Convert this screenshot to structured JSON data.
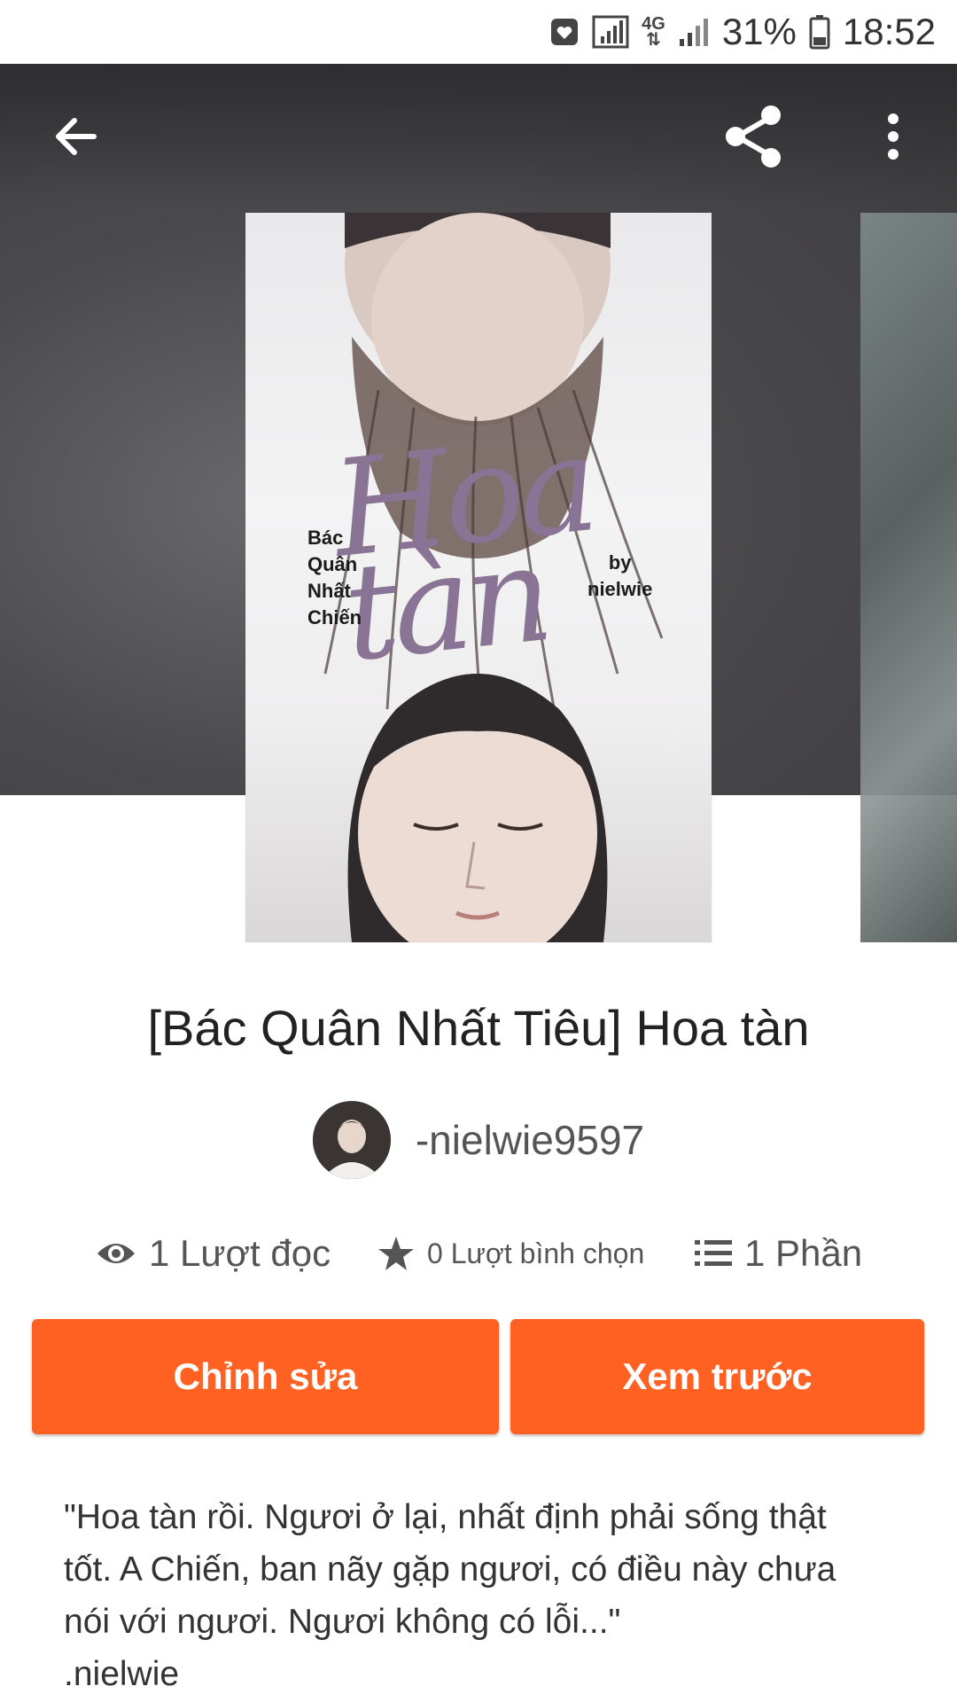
{
  "status_bar": {
    "network_label": "4G",
    "battery_percent": "31%",
    "time": "18:52"
  },
  "toolbar": {
    "back_icon": "arrow-left-icon",
    "share_icon": "share-icon",
    "more_icon": "more-vert-icon"
  },
  "cover": {
    "title_art": "Hoa tàn",
    "subtitle": "Bác\nQuân\nNhất\nChiến",
    "byline": "by\nnielwie"
  },
  "story": {
    "title": "[Bác Quân Nhất Tiêu] Hoa tàn",
    "author": "-nielwie9597",
    "stats": {
      "reads": "1 Lượt đọc",
      "votes": "0 Lượt bình chọn",
      "parts": "1 Phần"
    },
    "description": "\"Hoa tàn rồi. Ngươi ở lại, nhất định phải sống thật\ntốt. A Chiến, ban nãy gặp ngươi, có điều này chưa\nnói với ngươi. Ngươi không có lỗi...\"\n.nielwie"
  },
  "actions": {
    "edit_label": "Chỉnh sửa",
    "preview_label": "Xem trước"
  },
  "colors": {
    "accent": "#ff6122",
    "hero_bg": "#4a494c"
  }
}
